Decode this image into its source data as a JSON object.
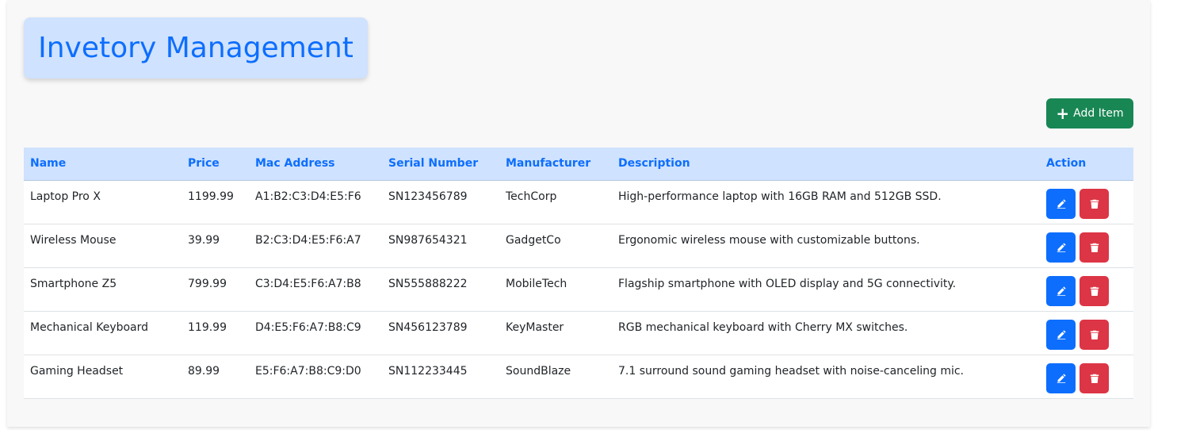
{
  "page": {
    "title": "Invetory Management",
    "add_button_label": "Add Item"
  },
  "colors": {
    "accent": "#0d6efd",
    "header_bg": "#cfe2ff",
    "add_button": "#198754",
    "delete_button": "#dc3545"
  },
  "table": {
    "headers": {
      "name": "Name",
      "price": "Price",
      "mac": "Mac Address",
      "serial": "Serial Number",
      "manufacturer": "Manufacturer",
      "description": "Description",
      "action": "Action"
    },
    "rows": [
      {
        "name": "Laptop Pro X",
        "price": "1199.99",
        "mac": "A1:B2:C3:D4:E5:F6",
        "serial": "SN123456789",
        "manufacturer": "TechCorp",
        "description": "High-performance laptop with 16GB RAM and 512GB SSD."
      },
      {
        "name": "Wireless Mouse",
        "price": "39.99",
        "mac": "B2:C3:D4:E5:F6:A7",
        "serial": "SN987654321",
        "manufacturer": "GadgetCo",
        "description": "Ergonomic wireless mouse with customizable buttons."
      },
      {
        "name": "Smartphone Z5",
        "price": "799.99",
        "mac": "C3:D4:E5:F6:A7:B8",
        "serial": "SN555888222",
        "manufacturer": "MobileTech",
        "description": "Flagship smartphone with OLED display and 5G connectivity."
      },
      {
        "name": "Mechanical Keyboard",
        "price": "119.99",
        "mac": "D4:E5:F6:A7:B8:C9",
        "serial": "SN456123789",
        "manufacturer": "KeyMaster",
        "description": "RGB mechanical keyboard with Cherry MX switches."
      },
      {
        "name": "Gaming Headset",
        "price": "89.99",
        "mac": "E5:F6:A7:B8:C9:D0",
        "serial": "SN112233445",
        "manufacturer": "SoundBlaze",
        "description": "7.1 surround sound gaming headset with noise-canceling mic."
      }
    ]
  },
  "icons": {
    "add": "plus-icon",
    "edit": "edit-icon",
    "delete": "trash-icon"
  }
}
